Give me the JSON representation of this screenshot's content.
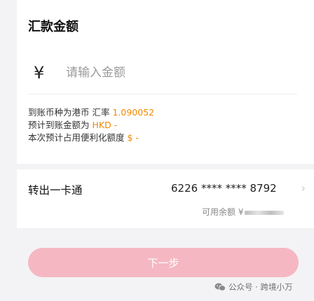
{
  "transfer": {
    "section_title": "汇款金额",
    "currency_symbol": "¥",
    "amount_placeholder": "请输入金额",
    "rate_line_prefix": "到账币种为港币 汇率 ",
    "rate_value": "1.090052",
    "estimate_line_prefix": "预计到账金额为 ",
    "estimate_value": "HKD -",
    "quota_line_prefix": "本次预计占用便利化额度 ",
    "quota_value": "$ -"
  },
  "payment": {
    "label": "转出一卡通",
    "card_number": "6226 **** **** 8792",
    "balance_label": "可用余额 ¥"
  },
  "actions": {
    "next_label": "下一步"
  },
  "watermark": {
    "text": "公众号 · 跨境小万"
  },
  "colors": {
    "highlight": "#f08a00",
    "button": "#f5b8c3"
  }
}
